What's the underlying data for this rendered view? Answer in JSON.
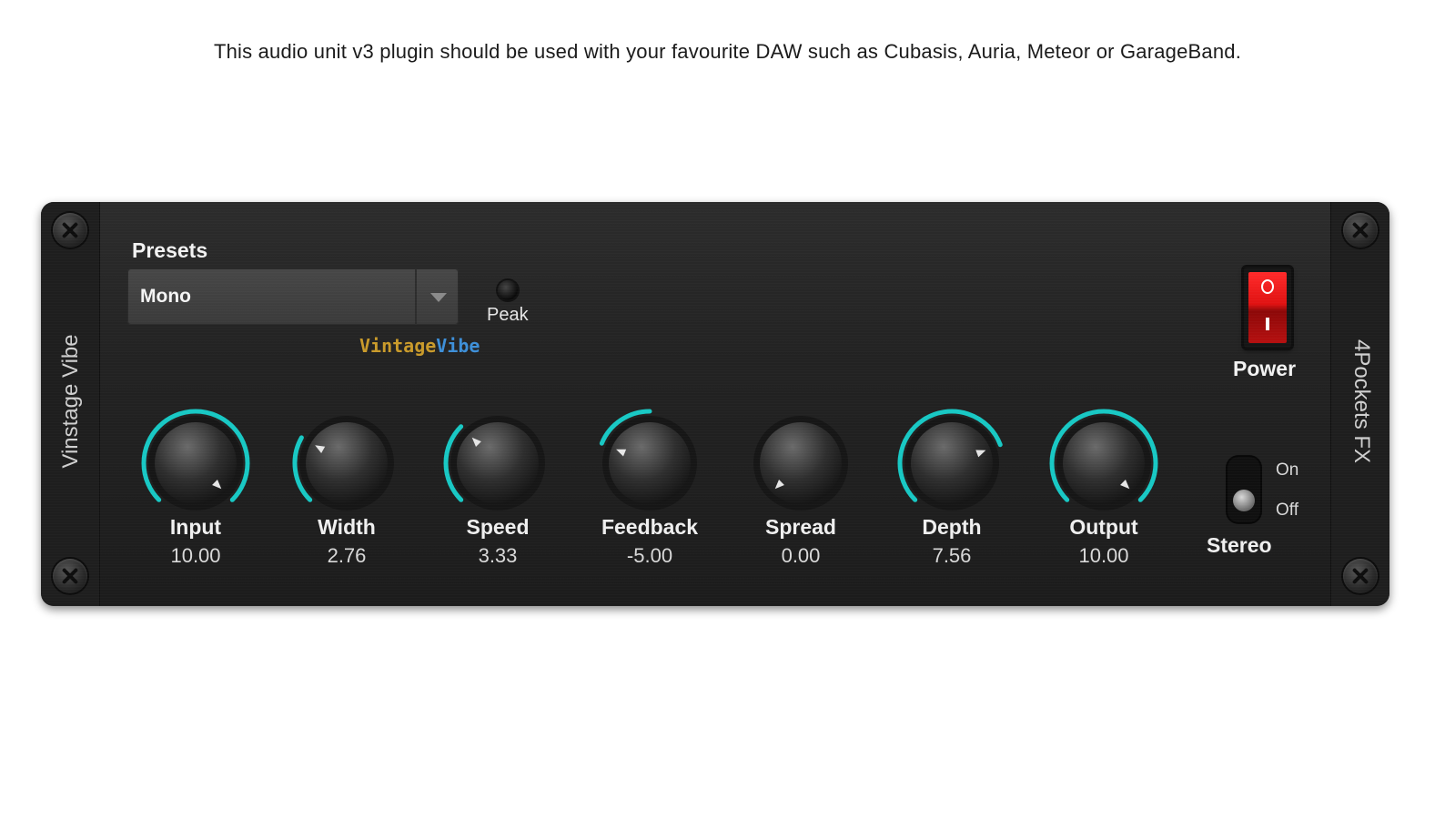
{
  "caption": "This audio unit v3 plugin should be used with your favourite DAW such as Cubasis, Auria, Meteor or GarageBand.",
  "plugin": {
    "name": "Vinstage Vibe",
    "vendor": "4Pockets FX",
    "logo_part1": "Vintage",
    "logo_part2": "Vibe",
    "accent_color": "#18c8c4"
  },
  "presets": {
    "label": "Presets",
    "selected": "Mono"
  },
  "peak": {
    "label": "Peak"
  },
  "power": {
    "label": "Power",
    "state": "on"
  },
  "stereo": {
    "label": "Stereo",
    "on_label": "On",
    "off_label": "Off",
    "state": "off"
  },
  "knobs": [
    {
      "label": "Input",
      "value": "10.00",
      "min": 0,
      "max": 10,
      "num": 10.0
    },
    {
      "label": "Width",
      "value": "2.76",
      "min": 0,
      "max": 10,
      "num": 2.76
    },
    {
      "label": "Speed",
      "value": "3.33",
      "min": 0,
      "max": 10,
      "num": 3.33
    },
    {
      "label": "Feedback",
      "value": "-5.00",
      "min": -10,
      "max": 10,
      "num": -5.0
    },
    {
      "label": "Spread",
      "value": "0.00",
      "min": 0,
      "max": 10,
      "num": 0.0
    },
    {
      "label": "Depth",
      "value": "7.56",
      "min": 0,
      "max": 10,
      "num": 7.56
    },
    {
      "label": "Output",
      "value": "10.00",
      "min": 0,
      "max": 10,
      "num": 10.0
    }
  ]
}
